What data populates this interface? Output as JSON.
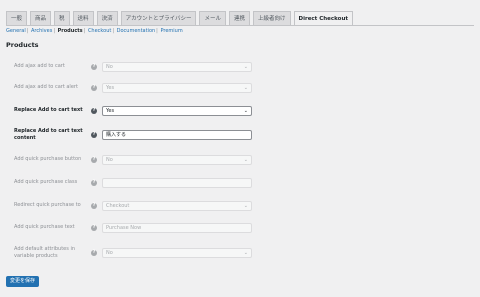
{
  "tabs": [
    "一般",
    "商品",
    "税",
    "送料",
    "決済",
    "アカウントとプライバシー",
    "メール",
    "連携",
    "上級者向け",
    "Direct Checkout"
  ],
  "subnav": [
    "General",
    "Archives",
    "Products",
    "Checkout",
    "Documentation",
    "Premium"
  ],
  "subnav_current": "Products",
  "section_title": "Products",
  "rows": [
    {
      "label": "Add ajax add to cart",
      "value": "No",
      "type": "select"
    },
    {
      "label": "Add ajax add to cart alert",
      "value": "Yes",
      "type": "select"
    },
    {
      "label": "Replace Add to cart text",
      "value": "Yes",
      "type": "select"
    },
    {
      "label": "Replace Add to cart text content",
      "value": "購入する",
      "type": "text"
    },
    {
      "label": "Add quick purchase button",
      "value": "No",
      "type": "select"
    },
    {
      "label": "Add quick purchase class",
      "value": "",
      "type": "text"
    },
    {
      "label": "Redirect quick purchase to",
      "value": "Checkout",
      "type": "select"
    },
    {
      "label": "Add quick purchase text",
      "value": "Purchase Now",
      "type": "text"
    },
    {
      "label": "Add default attributes in variable products",
      "value": "No",
      "type": "select"
    }
  ],
  "help_glyph": "?",
  "chevron_glyph": "⌄",
  "save_label": "変更を保存",
  "colors": {
    "accent": "#2271b1",
    "background": "#f0f0f1"
  }
}
